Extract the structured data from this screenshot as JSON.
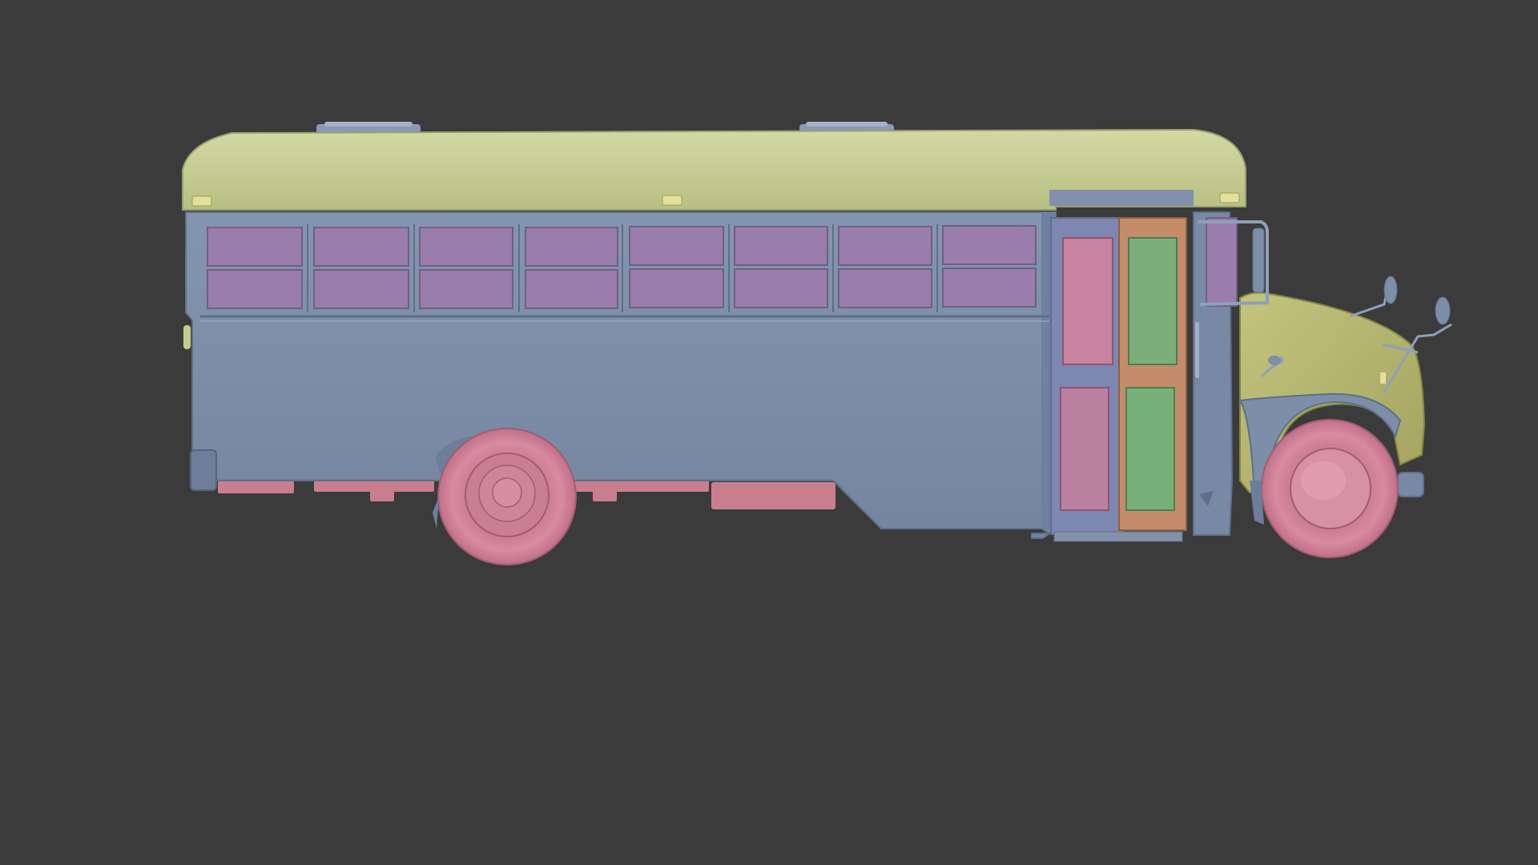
{
  "scene": {
    "background_color": "#3b3b3b",
    "subject": "bus-3d-model-side-view",
    "palette": {
      "roof": "#c4cb8f",
      "hood": "#b6b76d",
      "body": "#7d8ea8",
      "body_shadow": "#6c7c96",
      "windows": "#9a7cad",
      "door_front_panel": "#c7839f",
      "door_rear_panel": "#7bae7b",
      "door_frame_orange": "#c48c68",
      "wheels": "#d7899f",
      "undercarriage": "#c97e8e"
    }
  }
}
